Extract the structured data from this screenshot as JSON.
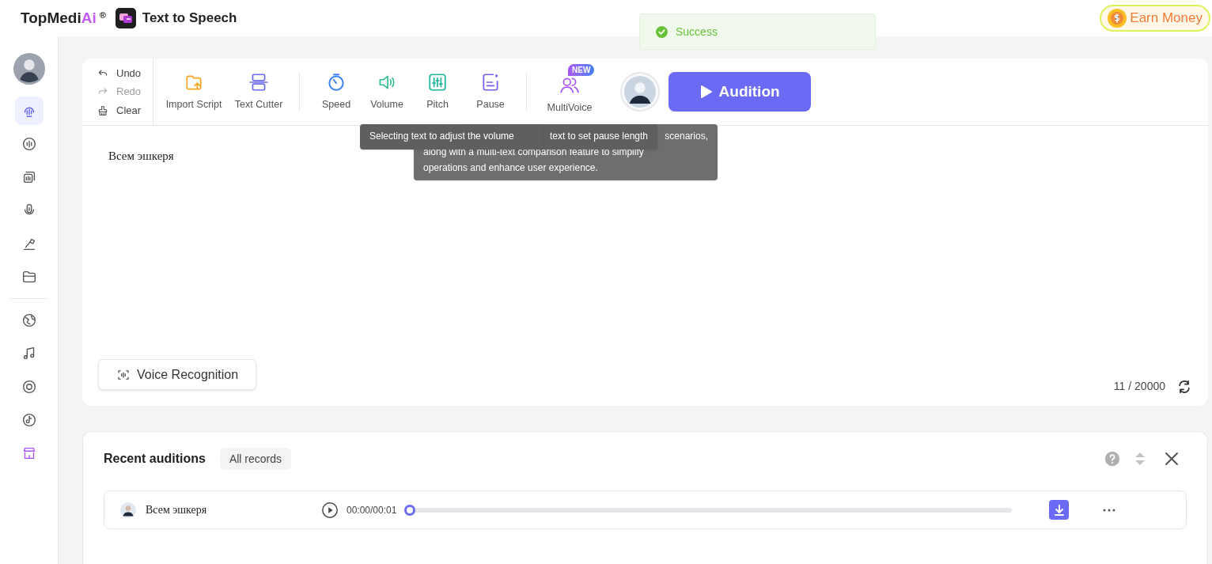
{
  "header": {
    "logo": "TopMedi",
    "logo_accent": "Ai",
    "logo_mark": "®",
    "app_title": "Text to Speech",
    "earn_button": "Earn Money"
  },
  "toast": {
    "text": "Success"
  },
  "sidebar": {
    "items": [
      {
        "selected": true,
        "accent": false
      },
      {
        "selected": false,
        "accent": false
      },
      {
        "selected": false,
        "accent": false
      },
      {
        "selected": false,
        "accent": false
      },
      {
        "selected": false,
        "accent": false
      },
      {
        "selected": false,
        "accent": false
      },
      {
        "selected": false,
        "accent": false
      },
      {
        "selected": false,
        "accent": false
      },
      {
        "selected": false,
        "accent": false
      },
      {
        "selected": false,
        "accent": false
      },
      {
        "selected": false,
        "accent": true
      }
    ]
  },
  "history": [
    {
      "label": "Undo",
      "disabled": false
    },
    {
      "label": "Redo",
      "disabled": true
    },
    {
      "label": "Clear",
      "disabled": false
    }
  ],
  "tools": [
    {
      "label": "Import Script",
      "color": "#f5a524"
    },
    {
      "label": "Text Cutter",
      "color": "#6c6cf0"
    },
    {
      "label": "Speed",
      "color": "#3b82f6"
    },
    {
      "label": "Volume",
      "color": "#34c38f"
    },
    {
      "label": "Pitch",
      "color": "#20b69e"
    },
    {
      "label": "Pause",
      "color": "#7c5cf0"
    },
    {
      "label": "MultiVoice",
      "color": "#a855f7",
      "badge": "NEW"
    }
  ],
  "audition_button": "Audition",
  "tooltips": [
    {
      "lines": [
        "Selecting text to adjust the volume"
      ]
    },
    {
      "lines": [
        "scenarios,",
        "along with a multi-text comparison feature to simplify",
        "operations and enhance user experience."
      ]
    },
    {
      "lines": [
        "text to set pause length"
      ]
    }
  ],
  "editor": {
    "text": "Всем эшкеря",
    "voice_recognition": "Voice Recognition",
    "counter": "11 / 20000"
  },
  "recent": {
    "title": "Recent auditions",
    "all_records": "All records",
    "rows": [
      {
        "text": "Всем эшкеря",
        "time": "00:00/00:01",
        "level": 0
      }
    ]
  }
}
